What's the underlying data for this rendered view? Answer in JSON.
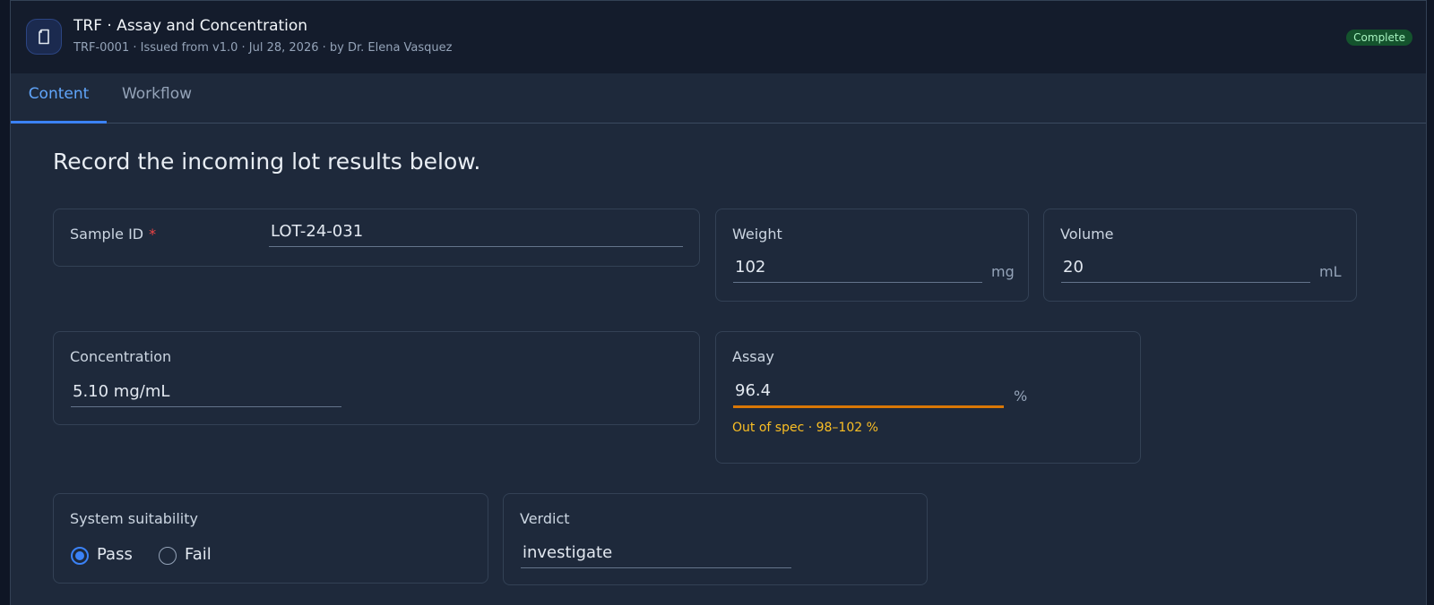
{
  "header": {
    "title": "TRF · Assay and Concentration",
    "subtitle": "TRF-0001 · Issued from v1.0 · Jul 28, 2026 · by Dr. Elena Vasquez",
    "status": "Complete",
    "icon": "document-icon"
  },
  "tabs": [
    {
      "label": "Content",
      "active": true
    },
    {
      "label": "Workflow",
      "active": false
    }
  ],
  "intro": "Record the incoming lot results below.",
  "fields": {
    "sample_id": {
      "label": "Sample ID",
      "required_mark": "*",
      "value": "LOT-24-031"
    },
    "weight": {
      "label": "Weight",
      "value": "102",
      "unit": "mg"
    },
    "volume": {
      "label": "Volume",
      "value": "20",
      "unit": "mL"
    },
    "concentration": {
      "label": "Concentration",
      "value": "5.10 mg/mL"
    },
    "assay": {
      "label": "Assay",
      "value": "96.4",
      "unit": "%",
      "warning": "Out of spec · 98–102 %"
    },
    "system_suitability": {
      "label": "System suitability",
      "options": [
        "Pass",
        "Fail"
      ],
      "selected": "Pass"
    },
    "verdict": {
      "label": "Verdict",
      "value": "investigate"
    }
  },
  "colors": {
    "accent": "#3b82f6",
    "warning": "#fbbf24",
    "status_bg": "#14532d",
    "required": "#ef4444"
  }
}
